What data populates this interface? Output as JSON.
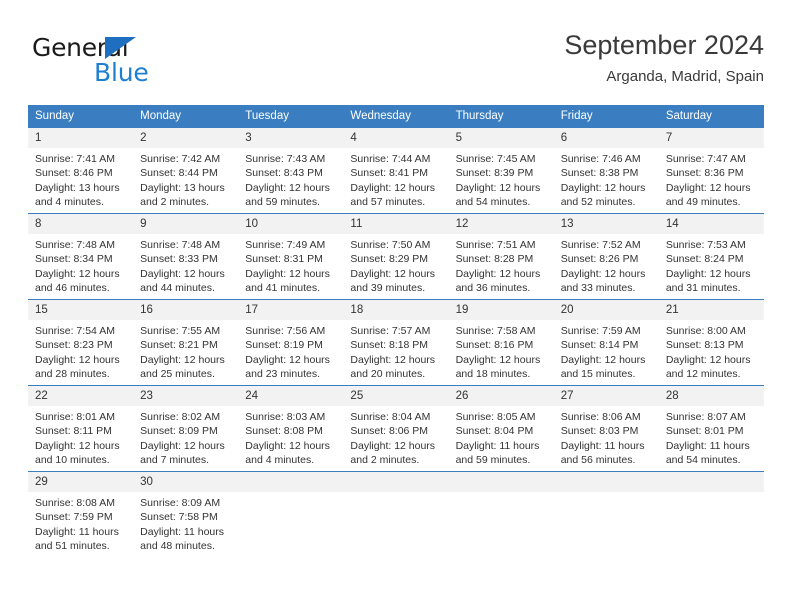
{
  "logo": {
    "word1": "General",
    "word2": "Blue",
    "triangle_color": "#1f6fc0",
    "blue_color": "#1f7fd0"
  },
  "header": {
    "title": "September 2024",
    "location": "Arganda, Madrid, Spain"
  },
  "theme": {
    "header_bg": "#3a7ec1",
    "daynum_bg": "#f2f2f2",
    "text": "#333333"
  },
  "weekday_headers": [
    "Sunday",
    "Monday",
    "Tuesday",
    "Wednesday",
    "Thursday",
    "Friday",
    "Saturday"
  ],
  "weeks": [
    [
      {
        "day": "1",
        "sunrise": "Sunrise: 7:41 AM",
        "sunset": "Sunset: 8:46 PM",
        "daylight": "Daylight: 13 hours and 4 minutes."
      },
      {
        "day": "2",
        "sunrise": "Sunrise: 7:42 AM",
        "sunset": "Sunset: 8:44 PM",
        "daylight": "Daylight: 13 hours and 2 minutes."
      },
      {
        "day": "3",
        "sunrise": "Sunrise: 7:43 AM",
        "sunset": "Sunset: 8:43 PM",
        "daylight": "Daylight: 12 hours and 59 minutes."
      },
      {
        "day": "4",
        "sunrise": "Sunrise: 7:44 AM",
        "sunset": "Sunset: 8:41 PM",
        "daylight": "Daylight: 12 hours and 57 minutes."
      },
      {
        "day": "5",
        "sunrise": "Sunrise: 7:45 AM",
        "sunset": "Sunset: 8:39 PM",
        "daylight": "Daylight: 12 hours and 54 minutes."
      },
      {
        "day": "6",
        "sunrise": "Sunrise: 7:46 AM",
        "sunset": "Sunset: 8:38 PM",
        "daylight": "Daylight: 12 hours and 52 minutes."
      },
      {
        "day": "7",
        "sunrise": "Sunrise: 7:47 AM",
        "sunset": "Sunset: 8:36 PM",
        "daylight": "Daylight: 12 hours and 49 minutes."
      }
    ],
    [
      {
        "day": "8",
        "sunrise": "Sunrise: 7:48 AM",
        "sunset": "Sunset: 8:34 PM",
        "daylight": "Daylight: 12 hours and 46 minutes."
      },
      {
        "day": "9",
        "sunrise": "Sunrise: 7:48 AM",
        "sunset": "Sunset: 8:33 PM",
        "daylight": "Daylight: 12 hours and 44 minutes."
      },
      {
        "day": "10",
        "sunrise": "Sunrise: 7:49 AM",
        "sunset": "Sunset: 8:31 PM",
        "daylight": "Daylight: 12 hours and 41 minutes."
      },
      {
        "day": "11",
        "sunrise": "Sunrise: 7:50 AM",
        "sunset": "Sunset: 8:29 PM",
        "daylight": "Daylight: 12 hours and 39 minutes."
      },
      {
        "day": "12",
        "sunrise": "Sunrise: 7:51 AM",
        "sunset": "Sunset: 8:28 PM",
        "daylight": "Daylight: 12 hours and 36 minutes."
      },
      {
        "day": "13",
        "sunrise": "Sunrise: 7:52 AM",
        "sunset": "Sunset: 8:26 PM",
        "daylight": "Daylight: 12 hours and 33 minutes."
      },
      {
        "day": "14",
        "sunrise": "Sunrise: 7:53 AM",
        "sunset": "Sunset: 8:24 PM",
        "daylight": "Daylight: 12 hours and 31 minutes."
      }
    ],
    [
      {
        "day": "15",
        "sunrise": "Sunrise: 7:54 AM",
        "sunset": "Sunset: 8:23 PM",
        "daylight": "Daylight: 12 hours and 28 minutes."
      },
      {
        "day": "16",
        "sunrise": "Sunrise: 7:55 AM",
        "sunset": "Sunset: 8:21 PM",
        "daylight": "Daylight: 12 hours and 25 minutes."
      },
      {
        "day": "17",
        "sunrise": "Sunrise: 7:56 AM",
        "sunset": "Sunset: 8:19 PM",
        "daylight": "Daylight: 12 hours and 23 minutes."
      },
      {
        "day": "18",
        "sunrise": "Sunrise: 7:57 AM",
        "sunset": "Sunset: 8:18 PM",
        "daylight": "Daylight: 12 hours and 20 minutes."
      },
      {
        "day": "19",
        "sunrise": "Sunrise: 7:58 AM",
        "sunset": "Sunset: 8:16 PM",
        "daylight": "Daylight: 12 hours and 18 minutes."
      },
      {
        "day": "20",
        "sunrise": "Sunrise: 7:59 AM",
        "sunset": "Sunset: 8:14 PM",
        "daylight": "Daylight: 12 hours and 15 minutes."
      },
      {
        "day": "21",
        "sunrise": "Sunrise: 8:00 AM",
        "sunset": "Sunset: 8:13 PM",
        "daylight": "Daylight: 12 hours and 12 minutes."
      }
    ],
    [
      {
        "day": "22",
        "sunrise": "Sunrise: 8:01 AM",
        "sunset": "Sunset: 8:11 PM",
        "daylight": "Daylight: 12 hours and 10 minutes."
      },
      {
        "day": "23",
        "sunrise": "Sunrise: 8:02 AM",
        "sunset": "Sunset: 8:09 PM",
        "daylight": "Daylight: 12 hours and 7 minutes."
      },
      {
        "day": "24",
        "sunrise": "Sunrise: 8:03 AM",
        "sunset": "Sunset: 8:08 PM",
        "daylight": "Daylight: 12 hours and 4 minutes."
      },
      {
        "day": "25",
        "sunrise": "Sunrise: 8:04 AM",
        "sunset": "Sunset: 8:06 PM",
        "daylight": "Daylight: 12 hours and 2 minutes."
      },
      {
        "day": "26",
        "sunrise": "Sunrise: 8:05 AM",
        "sunset": "Sunset: 8:04 PM",
        "daylight": "Daylight: 11 hours and 59 minutes."
      },
      {
        "day": "27",
        "sunrise": "Sunrise: 8:06 AM",
        "sunset": "Sunset: 8:03 PM",
        "daylight": "Daylight: 11 hours and 56 minutes."
      },
      {
        "day": "28",
        "sunrise": "Sunrise: 8:07 AM",
        "sunset": "Sunset: 8:01 PM",
        "daylight": "Daylight: 11 hours and 54 minutes."
      }
    ],
    [
      {
        "day": "29",
        "sunrise": "Sunrise: 8:08 AM",
        "sunset": "Sunset: 7:59 PM",
        "daylight": "Daylight: 11 hours and 51 minutes."
      },
      {
        "day": "30",
        "sunrise": "Sunrise: 8:09 AM",
        "sunset": "Sunset: 7:58 PM",
        "daylight": "Daylight: 11 hours and 48 minutes."
      },
      {
        "day": "",
        "sunrise": "",
        "sunset": "",
        "daylight": ""
      },
      {
        "day": "",
        "sunrise": "",
        "sunset": "",
        "daylight": ""
      },
      {
        "day": "",
        "sunrise": "",
        "sunset": "",
        "daylight": ""
      },
      {
        "day": "",
        "sunrise": "",
        "sunset": "",
        "daylight": ""
      },
      {
        "day": "",
        "sunrise": "",
        "sunset": "",
        "daylight": ""
      }
    ]
  ]
}
